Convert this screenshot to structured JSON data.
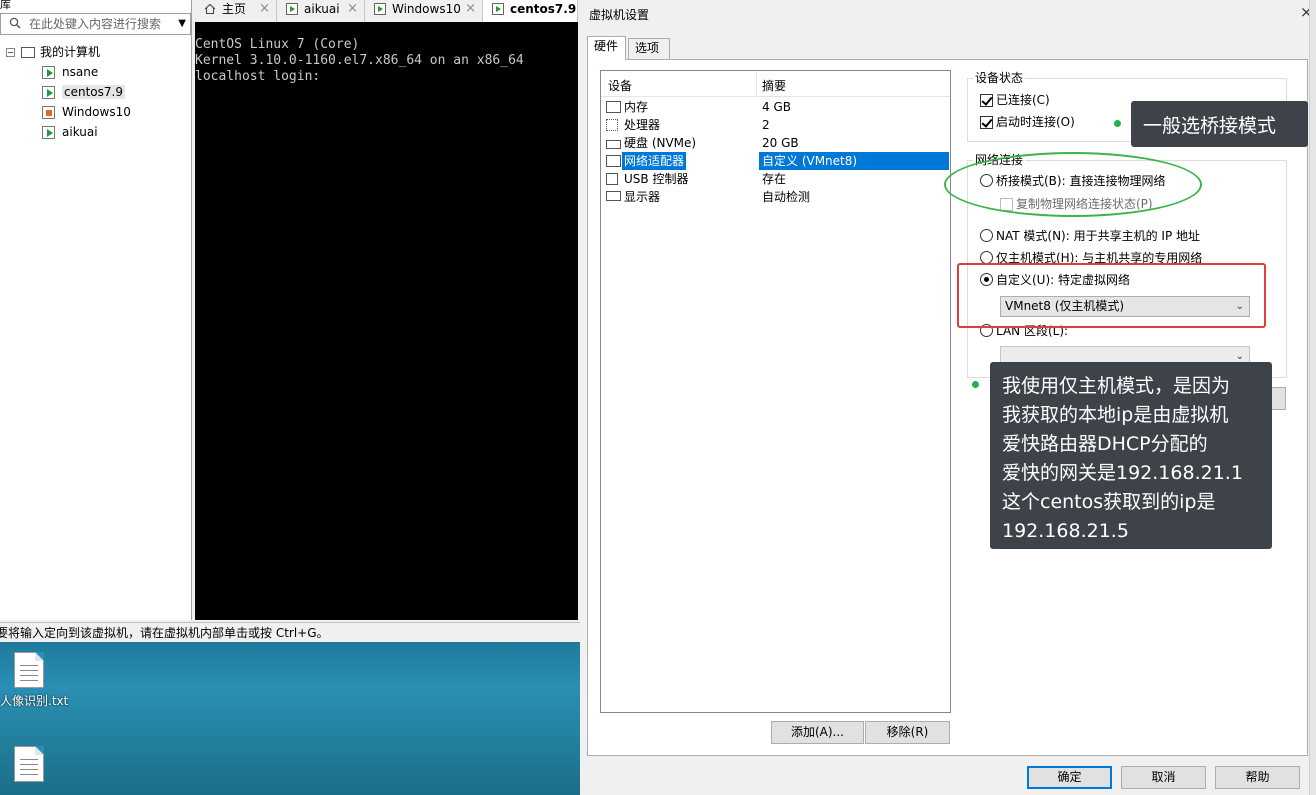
{
  "library": {
    "top_cut_text": "库",
    "search_placeholder": "在此处键入内容进行搜索",
    "tree": {
      "root_label": "我的计算机",
      "root_expander": "−",
      "items": [
        {
          "label": "nsane",
          "kind": "linux"
        },
        {
          "label": "centos7.9",
          "kind": "linux",
          "selected": true
        },
        {
          "label": "Windows10",
          "kind": "windows"
        },
        {
          "label": "aikuai",
          "kind": "linux"
        }
      ]
    }
  },
  "tabs": [
    {
      "label": "主页",
      "icon": "home-icon"
    },
    {
      "label": "aikuai",
      "icon": "vm-tab-icon"
    },
    {
      "label": "Windows10",
      "icon": "vm-tab-icon"
    },
    {
      "label": "centos7.9",
      "icon": "vm-tab-icon",
      "active": true
    }
  ],
  "console": {
    "lines": [
      "CentOS Linux 7 (Core)",
      "Kernel 3.10.0-1160.el7.x86_64 on an x86_64",
      "",
      "localhost login:"
    ]
  },
  "statusbar": {
    "text": "要将输入定向到该虚拟机，请在虚拟机内部单击或按 Ctrl+G。"
  },
  "desktop": {
    "file1_label": "人像识别.txt"
  },
  "dialog": {
    "title": "虚拟机设置",
    "close_glyph": "×",
    "tabs": [
      "硬件",
      "选项"
    ],
    "device_list": {
      "col_device": "设备",
      "col_summary": "摘要",
      "rows": [
        {
          "name": "内存",
          "summary": "4 GB",
          "icon": "memory-icon"
        },
        {
          "name": "处理器",
          "summary": "2",
          "icon": "cpu-icon"
        },
        {
          "name": "硬盘 (NVMe)",
          "summary": "20 GB",
          "icon": "hard-disk-icon"
        },
        {
          "name": "网络适配器",
          "summary": "自定义 (VMnet8)",
          "icon": "network-adapter-icon",
          "selected": true
        },
        {
          "name": "USB 控制器",
          "summary": "存在",
          "icon": "usb-icon"
        },
        {
          "name": "显示器",
          "summary": "自动检测",
          "icon": "monitor-icon"
        }
      ]
    },
    "add_button": "添加(A)...",
    "remove_button": "移除(R)",
    "device_status": {
      "title": "设备状态",
      "connected": "已连接(C)",
      "connect_at_power_on": "启动时连接(O)"
    },
    "network": {
      "title": "网络连接",
      "bridged": "桥接模式(B): 直接连接物理网络",
      "replicate": "复制物理网络连接状态(P)",
      "nat": "NAT 模式(N): 用于共享主机的 IP 地址",
      "host_only": "仅主机模式(H): 与主机共享的专用网络",
      "custom": "自定义(U): 特定虚拟网络",
      "custom_selected": "VMnet8 (仅主机模式)",
      "lan": "LAN 区段(L):"
    },
    "ok_button": "确定",
    "cancel_button": "取消",
    "help_button": "帮助"
  },
  "annotations": {
    "tip1": "一般选桥接模式",
    "tip2_lines": [
      "我使用仅主机模式，是因为",
      "我获取的本地ip是由虚拟机",
      "爱快路由器DHCP分配的",
      "爱快的网关是192.168.21.1",
      "这个centos获取到的ip是",
      "192.168.21.5"
    ],
    "ring_color": "#3bb44a",
    "box_color": "#e23d3d"
  }
}
